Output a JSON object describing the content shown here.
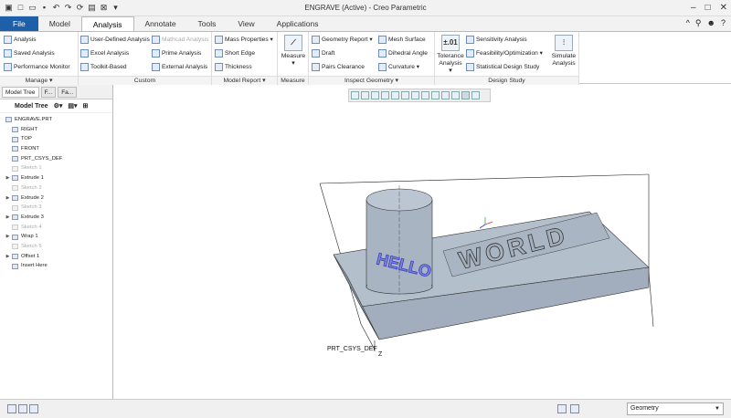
{
  "window": {
    "title": "ENGRAVE (Active) - Creo Parametric"
  },
  "tabs": [
    "File",
    "Model",
    "Analysis",
    "Annotate",
    "Tools",
    "View",
    "Applications"
  ],
  "active_tab": "Analysis",
  "ribbon": {
    "manage": {
      "label": "Manage ▾",
      "items": [
        "Analysis",
        "Saved Analysis",
        "Performance Monitor"
      ]
    },
    "custom": {
      "label": "Custom",
      "items": [
        "User-Defined Analysis",
        "Excel Analysis",
        "Toolkit-Based",
        "Mathcad Analysis",
        "Prime Analysis",
        "External Analysis"
      ]
    },
    "model_report": {
      "label": "Model Report ▾",
      "items": [
        "Mass Properties ▾",
        "Short Edge",
        "Thickness"
      ]
    },
    "measure": {
      "label": "Measure",
      "button": "Measure"
    },
    "inspect": {
      "label": "Inspect Geometry ▾",
      "items": [
        "Geometry Report ▾",
        "Draft",
        "Pairs Clearance",
        "Mesh Surface",
        "Dihedral Angle",
        "Curvature ▾"
      ]
    },
    "design_study": {
      "label": "Design Study",
      "tolerance_icon": "±.01",
      "tolerance": "Tolerance Analysis ▾",
      "items": [
        "Sensitivity Analysis",
        "Feasibility/Optimization ▾",
        "Statistical Design Study"
      ],
      "simulate": "Simulate Analysis"
    }
  },
  "panel": {
    "tabs": [
      "Model Tree",
      "F...",
      "Fa..."
    ],
    "toolbar_label": "Model Tree",
    "tree": [
      {
        "label": "ENGRAVE.PRT",
        "expand": "",
        "dim": false,
        "indent": 0
      },
      {
        "label": "RIGHT",
        "expand": "",
        "dim": false,
        "indent": 1
      },
      {
        "label": "TOP",
        "expand": "",
        "dim": false,
        "indent": 1
      },
      {
        "label": "FRONT",
        "expand": "",
        "dim": false,
        "indent": 1
      },
      {
        "label": "PRT_CSYS_DEF",
        "expand": "",
        "dim": false,
        "indent": 1
      },
      {
        "label": "Sketch 1",
        "expand": "",
        "dim": true,
        "indent": 1
      },
      {
        "label": "Extrude 1",
        "expand": "▶",
        "dim": false,
        "indent": 1
      },
      {
        "label": "Sketch 2",
        "expand": "",
        "dim": true,
        "indent": 1
      },
      {
        "label": "Extrude 2",
        "expand": "▶",
        "dim": false,
        "indent": 1
      },
      {
        "label": "Sketch 3",
        "expand": "",
        "dim": true,
        "indent": 1
      },
      {
        "label": "Extrude 3",
        "expand": "▶",
        "dim": false,
        "indent": 1
      },
      {
        "label": "Sketch 4",
        "expand": "",
        "dim": true,
        "indent": 1
      },
      {
        "label": "Wrap 1",
        "expand": "▶",
        "dim": false,
        "indent": 1
      },
      {
        "label": "Sketch 5",
        "expand": "",
        "dim": true,
        "indent": 1
      },
      {
        "label": "Offset 1",
        "expand": "▶",
        "dim": false,
        "indent": 1
      },
      {
        "label": "Insert Here",
        "expand": "",
        "dim": false,
        "indent": 1
      }
    ]
  },
  "viewport": {
    "engrave_text": "WORLD",
    "wrap_text": "HELLO",
    "csys_label": "PRT_CSYS_DEF",
    "axis_label": "Z"
  },
  "status": {
    "filter": "Geometry"
  },
  "colors": {
    "file_tab": "#1e5fa9",
    "part": "#b4bfcc",
    "wrap_text": "#3a3ad0"
  }
}
